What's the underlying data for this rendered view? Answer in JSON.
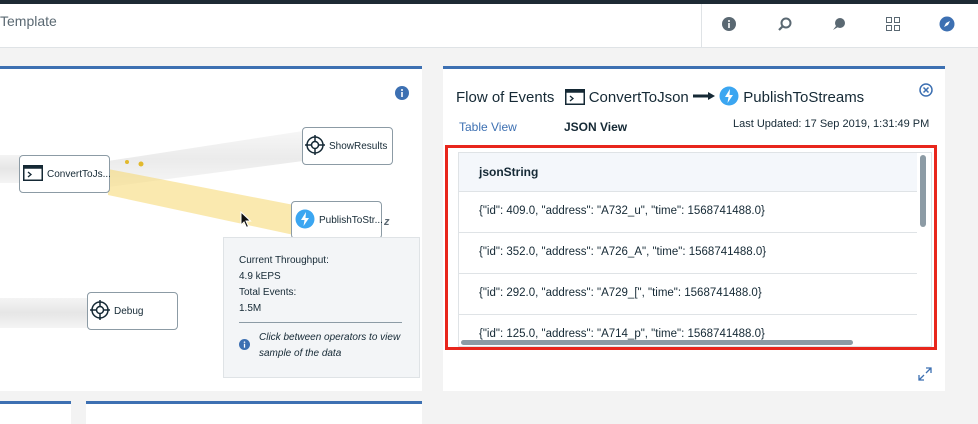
{
  "header": {
    "title": "Template",
    "icons": [
      "info-icon",
      "search-alert-icon",
      "chat-icon",
      "grid-icon",
      "compass-icon"
    ]
  },
  "graph": {
    "nodes": {
      "show_results": "ShowResults",
      "convert_to_json": "ConvertToJs...",
      "publish_to_streams": "PublishToStr...",
      "debug": "Debug"
    },
    "sleep_marker": "z",
    "tooltip": {
      "throughput_label": "Current Throughput:",
      "throughput_value": "4.9 kEPS",
      "events_label": "Total Events:",
      "events_value": "1.5M",
      "hint": "Click between operators to view sample of the data"
    }
  },
  "flow": {
    "title_prefix": "Flow of Events",
    "source": "ConvertToJson",
    "target": "PublishToStreams",
    "tabs": {
      "table": "Table View",
      "json": "JSON View"
    },
    "last_updated": "Last Updated: 17 Sep 2019, 1:31:49 PM",
    "column": "jsonString",
    "rows": [
      "{\"id\": 409.0, \"address\": \"A732_u\", \"time\": 1568741488.0}",
      "{\"id\": 352.0, \"address\": \"A726_A\", \"time\": 1568741488.0}",
      "{\"id\": 292.0, \"address\": \"A729_[\", \"time\": 1568741488.0}",
      "{\"id\": 125.0, \"address\": \"A714_p\", \"time\": 1568741488.0}"
    ]
  },
  "colors": {
    "accent": "#3d70b2",
    "highlight": "#e8261c",
    "flow": "#f5d76e"
  }
}
